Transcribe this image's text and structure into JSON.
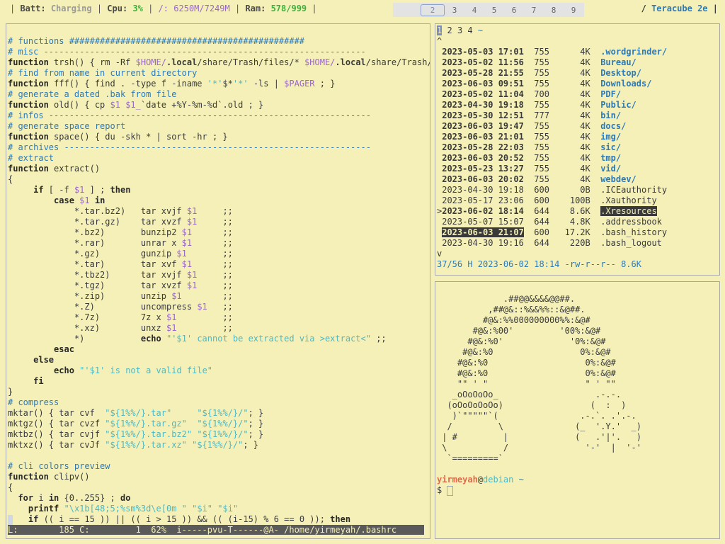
{
  "statusbar": {
    "batt_label": "Batt:",
    "batt_value": "Charging",
    "cpu_label": "Cpu:",
    "cpu_value": "3%",
    "disk_label": "/:",
    "disk_value": "6250M/7249M",
    "ram_label": "Ram:",
    "ram_value": "578/999",
    "workspaces": [
      "2",
      "3",
      "4",
      "5",
      "6",
      "7",
      "8",
      "9"
    ],
    "host_prefix": "/",
    "host": "Teracube 2e"
  },
  "vim": {
    "lines": [
      "",
      "# functions ##############################################",
      "# misc ---------------------------------------------------------------",
      "function trsh() { rm -Rf $HOME/.local/share/Trash/files/* $HOME/.local/share/Trash/i",
      "# find from name in current directory",
      "function fff() { find . -type f -iname '*'$*'*' -ls | $PAGER ; }",
      "# generate a dated .bak from file",
      "function old() { cp $1 $1_`date +%Y-%m-%d`.old ; }",
      "# infos ---------------------------------------------------------------",
      "# generate space report",
      "function space() { du -skh * | sort -hr ; }",
      "# archives ------------------------------------------------------------",
      "# extract",
      "function extract()",
      "{",
      "     if [ -f $1 ] ; then",
      "         case $1 in",
      "             *.tar.bz2)   tar xvjf $1     ;;",
      "             *.tar.gz)    tar xvzf $1     ;;",
      "             *.bz2)       bunzip2 $1      ;;",
      "             *.rar)       unrar x $1      ;;",
      "             *.gz)        gunzip $1       ;;",
      "             *.tar)       tar xvf $1      ;;",
      "             *.tbz2)      tar xvjf $1     ;;",
      "             *.tgz)       tar xvzf $1     ;;",
      "             *.zip)       unzip $1        ;;",
      "             *.Z)         uncompress $1   ;;",
      "             *.7z)        7z x $1         ;;",
      "             *.xz)        unxz $1         ;;",
      "             *)           echo \"'$1' cannot be extracted via >extract<\" ;;",
      "         esac",
      "     else",
      "         echo \"'$1' is not a valid file\"",
      "     fi",
      "}",
      "# compress",
      "mktar() { tar cvf  \"${1%%/}.tar\"     \"${1%%/}/\"; }",
      "mktgz() { tar cvzf \"${1%%/}.tar.gz\"  \"${1%%/}/\"; }",
      "mktbz() { tar cvjf \"${1%%/}.tar.bz2\" \"${1%%/}/\"; }",
      "mktxz() { tar cvJf \"${1%%/}.tar.xz\" \"${1%%/}/\"; }",
      "",
      "# cli colors preview",
      "function clipv()",
      "{",
      "  for i in {0..255} ; do",
      "    printf \"\\x1b[48;5;%sm%3d\\e[0m \" \"$i\" \"$i\"",
      "    if (( i == 15 )) || (( i > 15 )) && (( (i-15) % 6 == 0 )); then"
    ],
    "status": "L:        185 C:         1  62%  i-----pvu-T------@A- /home/yirmeyah/.bashrc"
  },
  "filemanager": {
    "tabs": [
      "1",
      "2",
      "3",
      "4",
      "~"
    ],
    "up_indicator": "^",
    "down_indicator": "v",
    "entries": [
      {
        "date": "2023-05-03 17:01",
        "perm": "755",
        "size": "4K",
        "name": ".wordgrinder/",
        "dir": true
      },
      {
        "date": "2023-05-02 11:56",
        "perm": "755",
        "size": "4K",
        "name": "Bureau/",
        "dir": true
      },
      {
        "date": "2023-05-28 21:55",
        "perm": "755",
        "size": "4K",
        "name": "Desktop/",
        "dir": true
      },
      {
        "date": "2023-06-03 09:51",
        "perm": "755",
        "size": "4K",
        "name": "Downloads/",
        "dir": true
      },
      {
        "date": "2023-05-02 11:04",
        "perm": "700",
        "size": "4K",
        "name": "PDF/",
        "dir": true
      },
      {
        "date": "2023-04-30 19:18",
        "perm": "755",
        "size": "4K",
        "name": "Public/",
        "dir": true
      },
      {
        "date": "2023-05-30 12:51",
        "perm": "777",
        "size": "4K",
        "name": "bin/",
        "dir": true
      },
      {
        "date": "2023-06-03 19:47",
        "perm": "755",
        "size": "4K",
        "name": "docs/",
        "dir": true
      },
      {
        "date": "2023-06-03 21:01",
        "perm": "755",
        "size": "4K",
        "name": "img/",
        "dir": true
      },
      {
        "date": "2023-05-28 22:03",
        "perm": "755",
        "size": "4K",
        "name": "sic/",
        "dir": true
      },
      {
        "date": "2023-06-03 20:52",
        "perm": "755",
        "size": "4K",
        "name": "tmp/",
        "dir": true
      },
      {
        "date": "2023-05-23 13:27",
        "perm": "755",
        "size": "4K",
        "name": "vid/",
        "dir": true
      },
      {
        "date": "2023-06-03 20:02",
        "perm": "755",
        "size": "4K",
        "name": "webdev/",
        "dir": true
      },
      {
        "date": "2023-04-30 19:18",
        "perm": "600",
        "size": "0B",
        "name": ".ICEauthority",
        "dir": false
      },
      {
        "date": "2023-05-17 23:06",
        "perm": "600",
        "size": "100B",
        "name": ".Xauthority",
        "dir": false
      },
      {
        "date": "2023-06-02 18:14",
        "perm": "644",
        "size": "8.6K",
        "name": ".Xresources",
        "dir": false,
        "cursor": true
      },
      {
        "date": "2023-05-07 15:07",
        "perm": "644",
        "size": "4.8K",
        "name": ".addressbook",
        "dir": false
      },
      {
        "date": "2023-06-03 21:07",
        "perm": "600",
        "size": "17.2K",
        "name": ".bash_history",
        "dir": false,
        "marked": true
      },
      {
        "date": "2023-04-30 19:16",
        "perm": "644",
        "size": "220B",
        "name": ".bash_logout",
        "dir": false
      }
    ],
    "status": "37/56 H 2023-06-02 18:14 -rw-r--r-- 8.6K"
  },
  "shell": {
    "art": [
      "",
      "             .##@@&&&&@@##.",
      "          ,##@&::%&&%%::&@##.",
      "         #@&:%%000000000%%:&@#",
      "       #@&:%00'         '00%:&@#",
      "      #@&:%0'             '0%:&@#",
      "     #@&:%0                 0%:&@#",
      "    #@&:%0                   0%:&@#",
      "    #@&:%0                   0%:&@#",
      "    \"\" ' \"                   \" ' \"\"",
      "   _oOoOoOo_                   .-.-.",
      "  (oOoOoOoOo)                 (  :  )",
      "   )`\"\"\"\"\"`(                .-.`. .'.-.",
      "  /         \\              (_  '.Y.'  _)",
      " | #         |             (   .'|'.   )",
      " \\           /               '-'  |  '-'",
      "  `=========`",
      "",
      ""
    ],
    "prompt_user": "yirmeyah",
    "prompt_at": "@",
    "prompt_host": "debian",
    "prompt_path": "~",
    "prompt_symbol": "$"
  },
  "colors": {
    "background": "#f4f0b7",
    "accent_blue": "#2e7ab8",
    "string_cyan": "#4db8c4",
    "variable_purple": "#9966cc",
    "cpu_green": "#3db13d",
    "prompt_orange": "#e06a4a"
  }
}
